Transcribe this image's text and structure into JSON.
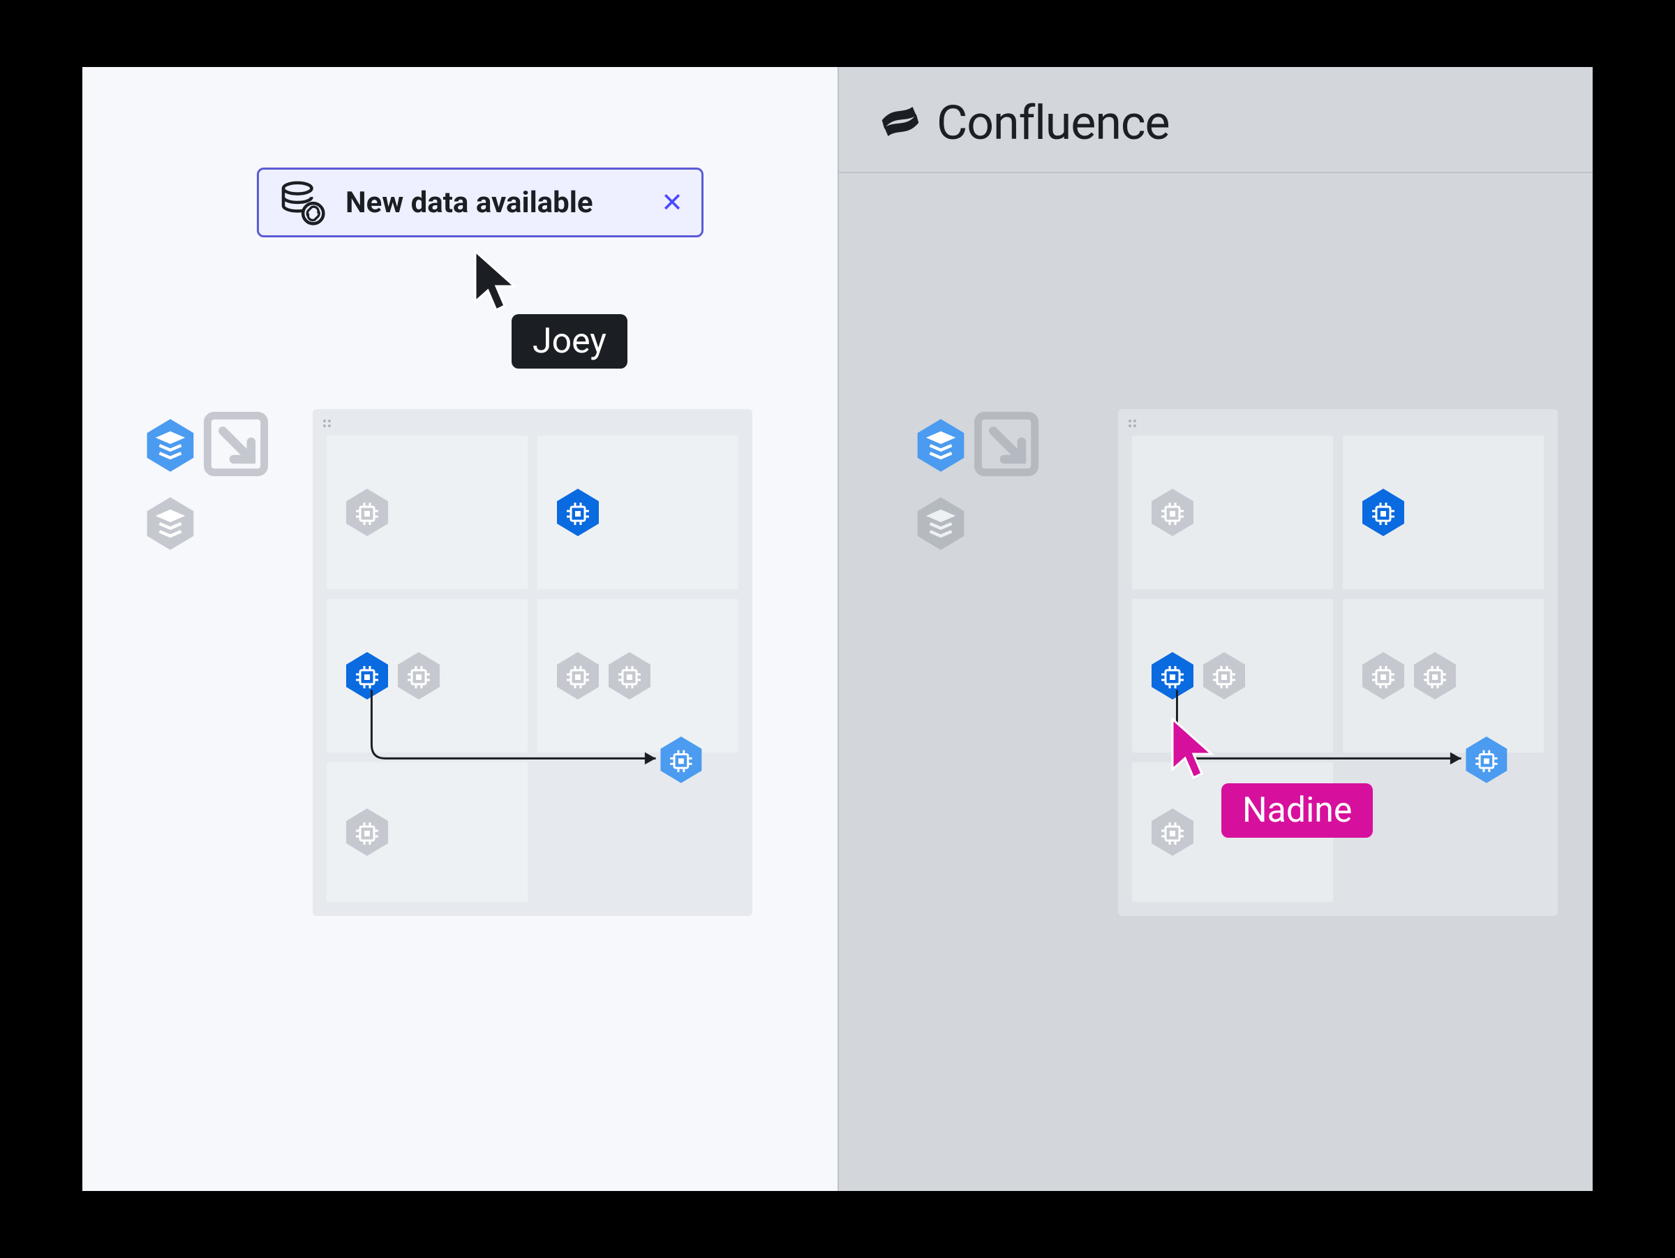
{
  "notification": {
    "text": "New data available",
    "close": "✕"
  },
  "users": {
    "left": "Joey",
    "right": "Nadine"
  },
  "app": {
    "name": "Confluence"
  },
  "colors": {
    "accent": "#5b5bd6",
    "blue_dark": "#0a6ae0",
    "blue_light": "#4b9bf0",
    "grey": "#c5c9cf",
    "pink": "#d6109d"
  }
}
